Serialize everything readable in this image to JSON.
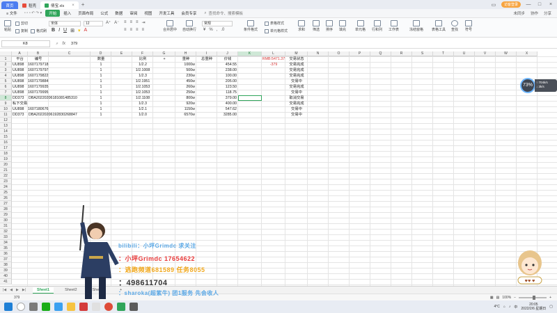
{
  "titlebar": {
    "tabs": [
      {
        "label": "首页",
        "kind": "home"
      },
      {
        "label": "稻壳",
        "kind": "normal"
      },
      {
        "label": "倩宝.xls",
        "kind": "active"
      }
    ],
    "login_label": "访客登录",
    "colors": {
      "home": "#4c7df0",
      "login": "#f7a440"
    }
  },
  "menubar": {
    "file_label": "文件",
    "items": [
      "开始",
      "插入",
      "页面布局",
      "公式",
      "数据",
      "审阅",
      "视图",
      "开发工具",
      "会员专享"
    ],
    "active_item": "开始",
    "search_label": "查找命令、搜索模板",
    "right_items": [
      "未同步",
      "协作",
      "分享"
    ],
    "accent": "#2fa55a"
  },
  "toolbar": {
    "paste_label": "粘贴",
    "cut_label": "剪切",
    "copy_label": "复制",
    "format_painter_label": "格式刷",
    "font_name": "宋体",
    "font_size": "12",
    "bold": "B",
    "italic": "I",
    "underline": "U",
    "merge_label": "合并居中",
    "wrap_label": "自动换行",
    "number_format": "常规",
    "cond_format_label": "条件格式",
    "table_style_label": "表格样式",
    "cell_style_label": "单元格样式",
    "sum_label": "求和",
    "filter_label": "筛选",
    "sort_label": "排序",
    "fill_label": "填充",
    "cell_label": "单元格",
    "rowcol_label": "行和列",
    "worksheet_label": "工作表",
    "freeze_label": "冻结窗格",
    "table_tools_label": "表格工具",
    "find_label": "查找",
    "symbol_label": "符号"
  },
  "formulabar": {
    "cell_ref": "K8",
    "fx": "fx",
    "value": "379"
  },
  "sheet": {
    "columns": [
      "A",
      "B",
      "C",
      "D",
      "E",
      "F",
      "G",
      "H",
      "I",
      "J",
      "K",
      "L",
      "M",
      "N",
      "O",
      "P",
      "Q",
      "R",
      "S",
      "T",
      "U",
      "V",
      "W",
      "X"
    ],
    "selected_column": "K",
    "selected_row": 8,
    "row_count": 41,
    "header": [
      "平台",
      "编号",
      "",
      "数量",
      "",
      "比例",
      "+",
      "重种",
      "总重种",
      "价钱",
      "",
      "",
      "交易状态"
    ],
    "rows": [
      [
        "UU898",
        "1607179718",
        "",
        "1",
        "",
        "1/2.2",
        "",
        "1000w",
        "",
        "454.55",
        "",
        "",
        "交易完成"
      ],
      [
        "UU898",
        "1607179797",
        "",
        "1",
        "",
        "1/2.1008",
        "",
        "500w",
        "",
        "238.00",
        "",
        "",
        "交易完成"
      ],
      [
        "UU898",
        "1607179822",
        "",
        "1",
        "",
        "1/2.3",
        "",
        "230w",
        "",
        "100.00",
        "",
        "",
        "交易完成"
      ],
      [
        "UU898",
        "1607179884",
        "",
        "1",
        "",
        "1/2.1951",
        "",
        "450w",
        "",
        "205.00",
        "",
        "",
        "交易中"
      ],
      [
        "UU898",
        "1607179935",
        "",
        "1",
        "",
        "1/2.1053",
        "",
        "260w",
        "",
        "123.50",
        "",
        "",
        "交易完成"
      ],
      [
        "UU898",
        "1607179995",
        "",
        "1",
        "",
        "1/2.1053",
        "",
        "250w",
        "",
        "118.75",
        "",
        "",
        "交易中"
      ],
      [
        "DD373",
        "DBA20220206181081485310",
        "",
        "1",
        "",
        "1/2.1108",
        "",
        "800w",
        "",
        "379.00",
        "",
        "",
        "取消交易"
      ],
      [
        "私下交易",
        "",
        "",
        "1",
        "",
        "1/2.3",
        "",
        "920w",
        "",
        "400.00",
        "",
        "",
        "交易完成"
      ],
      [
        "UU898",
        "1607180676",
        "",
        "1",
        "",
        "1/2.1",
        "",
        "1150w",
        "",
        "547.62",
        "",
        "",
        "交易中"
      ],
      [
        "DD373",
        "DBA20220206192830268847",
        "",
        "1",
        "",
        "1/2.0",
        "",
        "6570w",
        "",
        "3285.00",
        "",
        "",
        "交易中"
      ]
    ],
    "extra_cells": [
      {
        "row": 1,
        "col": "L",
        "value": "RMB:5471.37",
        "color": "#d63232"
      },
      {
        "row": 2,
        "col": "L",
        "value": "-379",
        "color": "#d63232"
      }
    ]
  },
  "sheet_tabs": {
    "tabs": [
      "Sheet1",
      "Sheet2",
      "Sheet3"
    ],
    "active": "Sheet1",
    "add": "+"
  },
  "statusbar": {
    "left_value": "379",
    "zoom": "100%",
    "zoom_fraction": 0.5
  },
  "taskbar": {
    "time": "20:05",
    "date": "2022/2/6 星期日",
    "lang": "中",
    "temp": "4°C"
  },
  "overlay": {
    "speed_percent": "73",
    "speed_up": "↑ 704k/s",
    "speed_down": "↓ 3k/s",
    "lines": [
      "bilibili：小坪Grimdc 求关注",
      "：小坪Grimdc 17654622",
      "：逃跑频道681589 任务8055",
      "：498611704",
      "：sharoka(超紫牛) 团1服务 先会收人"
    ]
  }
}
